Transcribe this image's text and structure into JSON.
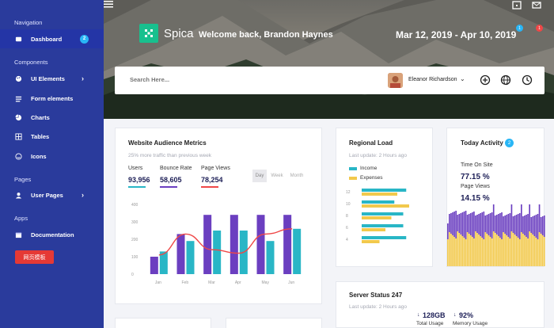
{
  "sidebar": {
    "sections": {
      "navigation": "Navigation",
      "components": "Components",
      "pages": "Pages",
      "apps": "Apps"
    },
    "items": [
      {
        "label": "Dashboard",
        "badge": "2"
      },
      {
        "label": "UI Elements"
      },
      {
        "label": "Form elements"
      },
      {
        "label": "Charts"
      },
      {
        "label": "Tables"
      },
      {
        "label": "Icons"
      },
      {
        "label": "User Pages"
      },
      {
        "label": "Documentation"
      }
    ],
    "red_button": "网页模板"
  },
  "header": {
    "brand": "Spica",
    "welcome": "Welcome back, Brandon Haynes",
    "date_range": "Mar 12, 2019 - Apr 10, 2019",
    "badges": [
      "1",
      "1"
    ]
  },
  "search": {
    "placeholder": "Search Here...",
    "user_name": "Eleanor Richardson"
  },
  "audience": {
    "title": "Website Audience Metrics",
    "subtitle": "25% more traffic than previous week",
    "stats": [
      {
        "label": "Users",
        "value": "93,956",
        "color": "#29b6c6"
      },
      {
        "label": "Bounce Rate",
        "value": "58,605",
        "color": "#6b3fc0"
      },
      {
        "label": "Page Views",
        "value": "78,254",
        "color": "#ef4747"
      }
    ],
    "toggles": [
      "Day",
      "Week",
      "Month"
    ]
  },
  "chart_data": [
    {
      "type": "bar",
      "categories": [
        "Jan",
        "Feb",
        "Mar",
        "Apr",
        "May",
        "Jun"
      ],
      "y_ticks": [
        0,
        100,
        200,
        300,
        400
      ],
      "ylim": [
        0,
        400
      ],
      "series": [
        {
          "values": [
            100,
            230,
            340,
            340,
            340,
            340
          ],
          "color": "#6b3fc0"
        },
        {
          "values": [
            130,
            190,
            250,
            250,
            190,
            260
          ],
          "color": "#29b6c6"
        },
        {
          "values": [
            110,
            230,
            140,
            120,
            230,
            260
          ],
          "color": "#ef4747"
        }
      ]
    },
    {
      "type": "bar",
      "orientation": "horizontal",
      "categories": [
        "12",
        "10",
        "8",
        "6",
        "4"
      ],
      "series": [
        {
          "name": "Income",
          "values": [
            75,
            55,
            70,
            70,
            75
          ],
          "color": "#29b6c6"
        },
        {
          "name": "Expenses",
          "values": [
            60,
            80,
            50,
            40,
            30
          ],
          "color": "#f2c94c"
        }
      ]
    }
  ],
  "regional": {
    "title": "Regional Load",
    "updated": "Last update: 2 Hours ago",
    "legend": [
      "Income",
      "Expenses"
    ]
  },
  "activity": {
    "title": "Today Activity",
    "badge": "2",
    "time_label": "Time On Site",
    "pct1": "77.15 %",
    "pct1_label": "Page Views",
    "pct2": "14.15 %"
  },
  "server": {
    "title": "Server Status 247",
    "updated": "Last update: 2 Hours ago",
    "usage_value": "128GB",
    "usage_label": "Total Usage",
    "mem_value": "92%",
    "mem_label": "Memory Usage"
  }
}
